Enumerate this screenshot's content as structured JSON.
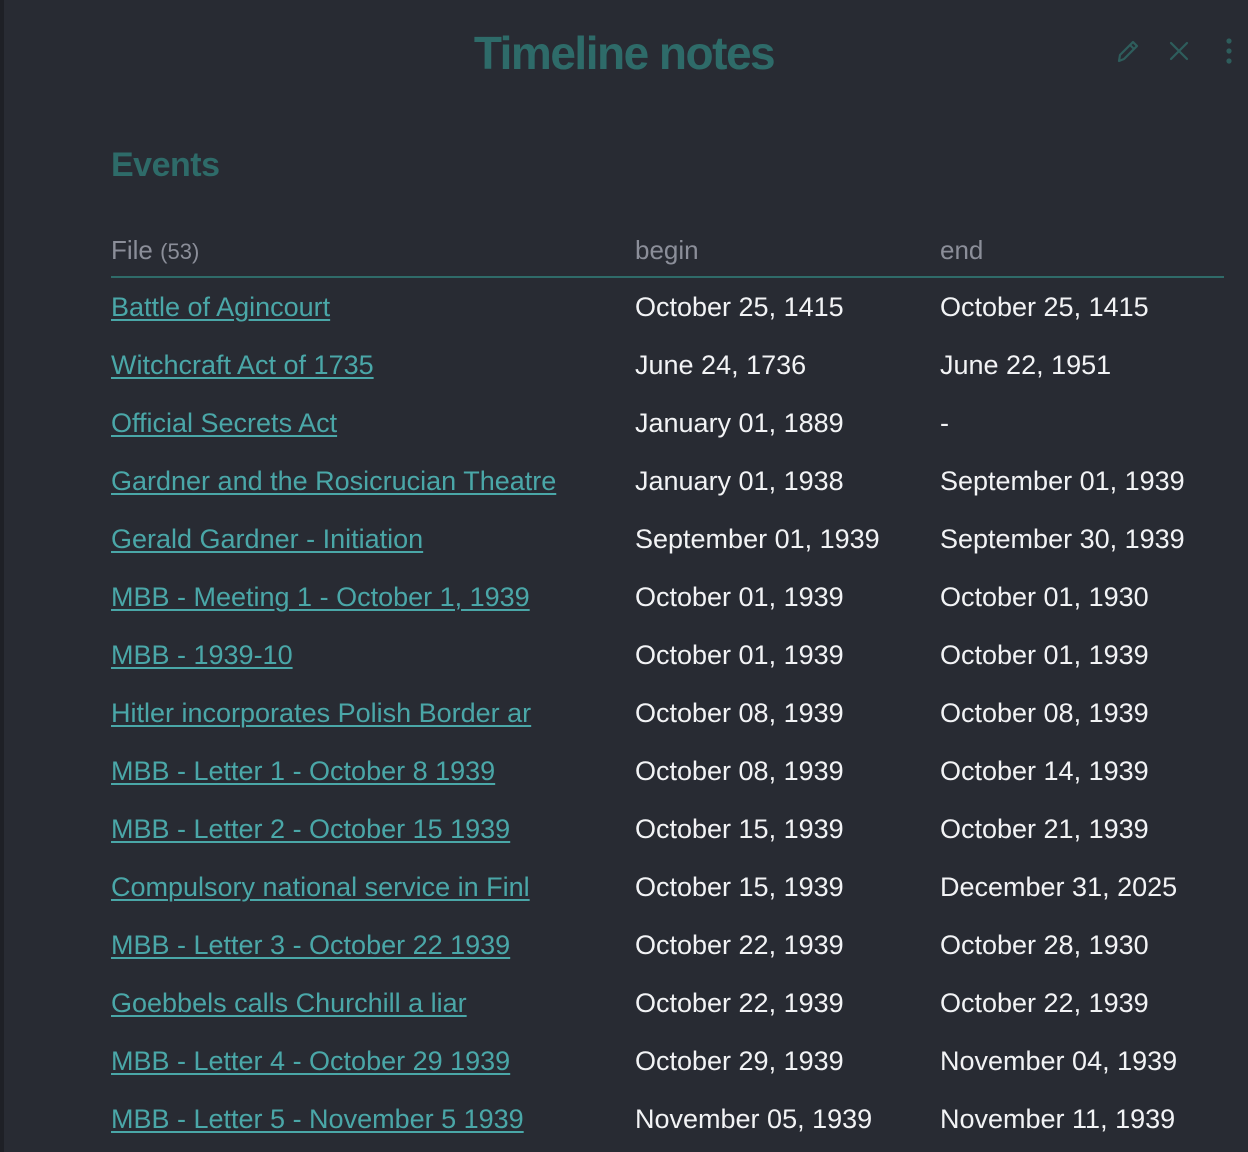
{
  "header": {
    "title": "Timeline notes",
    "icons": {
      "edit": "pencil-icon",
      "close": "close-icon",
      "more": "more-vertical-icon"
    }
  },
  "colors": {
    "background": "#282b33",
    "accent": "#2e6b69",
    "link": "#4aa7a8",
    "header_text": "#8b8e99",
    "body_text": "#f2f3f5"
  },
  "section": {
    "title": "Events"
  },
  "table": {
    "columns": {
      "file": "File",
      "file_count": "(53)",
      "begin": "begin",
      "end": "end"
    },
    "rows": [
      {
        "file": "Battle of Agincourt",
        "begin": "October 25, 1415",
        "end": "October 25, 1415"
      },
      {
        "file": "Witchcraft Act of 1735",
        "begin": "June 24, 1736",
        "end": "June 22, 1951"
      },
      {
        "file": "Official Secrets Act",
        "begin": "January 01, 1889",
        "end": "-"
      },
      {
        "file": "Gardner and the Rosicrucian Theatre",
        "begin": "January 01, 1938",
        "end": "September 01, 1939"
      },
      {
        "file": "Gerald Gardner - Initiation",
        "begin": "September 01, 1939",
        "end": "September 30, 1939"
      },
      {
        "file": "MBB - Meeting 1 - October 1, 1939",
        "begin": "October 01, 1939",
        "end": "October 01, 1930"
      },
      {
        "file": "MBB - 1939-10",
        "begin": "October 01, 1939",
        "end": "October 01, 1939"
      },
      {
        "file": "Hitler incorporates Polish Border ar",
        "begin": "October 08, 1939",
        "end": "October 08, 1939"
      },
      {
        "file": "MBB - Letter 1 - October 8 1939",
        "begin": "October 08, 1939",
        "end": "October 14, 1939"
      },
      {
        "file": "MBB - Letter 2 - October 15 1939",
        "begin": "October 15, 1939",
        "end": "October 21, 1939"
      },
      {
        "file": "Compulsory national service in Finl",
        "begin": "October 15, 1939",
        "end": "December 31, 2025"
      },
      {
        "file": "MBB - Letter 3 - October 22 1939",
        "begin": "October 22, 1939",
        "end": "October 28, 1930"
      },
      {
        "file": "Goebbels calls Churchill a liar",
        "begin": "October 22, 1939",
        "end": "October 22, 1939"
      },
      {
        "file": "MBB - Letter 4 - October 29 1939",
        "begin": "October 29, 1939",
        "end": "November 04, 1939"
      },
      {
        "file": "MBB - Letter 5 - November 5 1939",
        "begin": "November 05, 1939",
        "end": "November 11, 1939"
      }
    ]
  }
}
